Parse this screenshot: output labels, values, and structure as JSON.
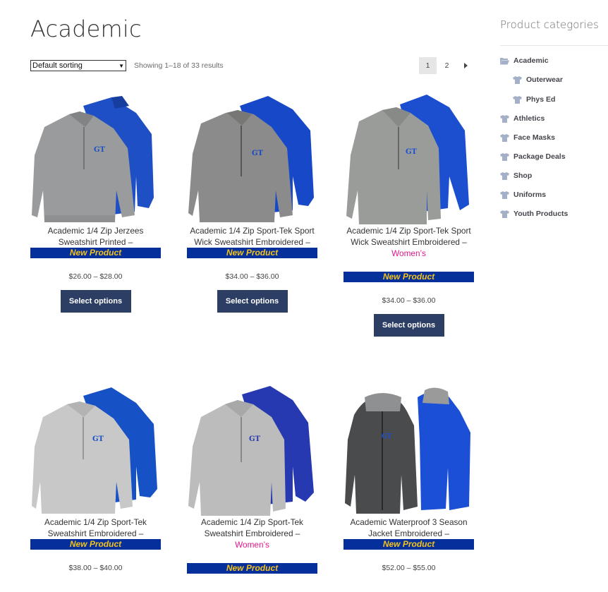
{
  "page": {
    "title": "Academic"
  },
  "toolbar": {
    "sorting": "Default sorting",
    "result_count": "Showing 1–18 of 33 results",
    "pages": [
      "1",
      "2"
    ]
  },
  "products": [
    {
      "title1": "Academic 1/4 Zip Jerzees",
      "title2": "Sweatshirt Printed –",
      "badge": "New Product",
      "price": "$26.00 – $28.00",
      "button": "Select options"
    },
    {
      "title1": "Academic 1/4 Zip Sport-Tek Sport",
      "title2": "Wick Sweatshirt Embroidered –",
      "badge": "New Product",
      "price": "$34.00 – $36.00",
      "button": "Select options"
    },
    {
      "title1": "Academic 1/4 Zip Sport-Tek Sport",
      "title2": "Wick Sweatshirt Embroidered –",
      "womens": "Women’s",
      "badge": "New Product",
      "price": "$34.00 – $36.00",
      "button": "Select options"
    },
    {
      "title1": "Academic 1/4 Zip Sport-Tek",
      "title2": "Sweatshirt Embroidered –",
      "badge": "New Product",
      "price": "$38.00 – $40.00"
    },
    {
      "title1": "Academic 1/4 Zip Sport-Tek",
      "title2": "Sweatshirt Embroidered –",
      "womens": "Women’s",
      "badge": "New Product"
    },
    {
      "title1": "Academic Waterproof 3 Season",
      "title2": "Jacket Embroidered –",
      "badge": "New Product",
      "price": "$52.00 – $55.00"
    }
  ],
  "sidebar": {
    "title": "Product categories",
    "categories": [
      {
        "label": "Academic",
        "icon": "folder-open-icon"
      },
      {
        "label": "Outerwear",
        "icon": "tshirt-icon"
      },
      {
        "label": "Phys Ed",
        "icon": "tshirt-icon"
      },
      {
        "label": "Athletics",
        "icon": "tshirt-icon"
      },
      {
        "label": "Face Masks",
        "icon": "tshirt-icon"
      },
      {
        "label": "Package Deals",
        "icon": "tshirt-icon"
      },
      {
        "label": "Shop",
        "icon": "tshirt-icon"
      },
      {
        "label": "Uniforms",
        "icon": "tshirt-icon"
      },
      {
        "label": "Youth Products",
        "icon": "tshirt-icon"
      }
    ]
  },
  "colors": {
    "badge_bg": "#05309c",
    "badge_text": "#f5c21b",
    "womens": "#e0188c",
    "button_bg": "#2c3e64",
    "icon": "#a3b0c8"
  }
}
